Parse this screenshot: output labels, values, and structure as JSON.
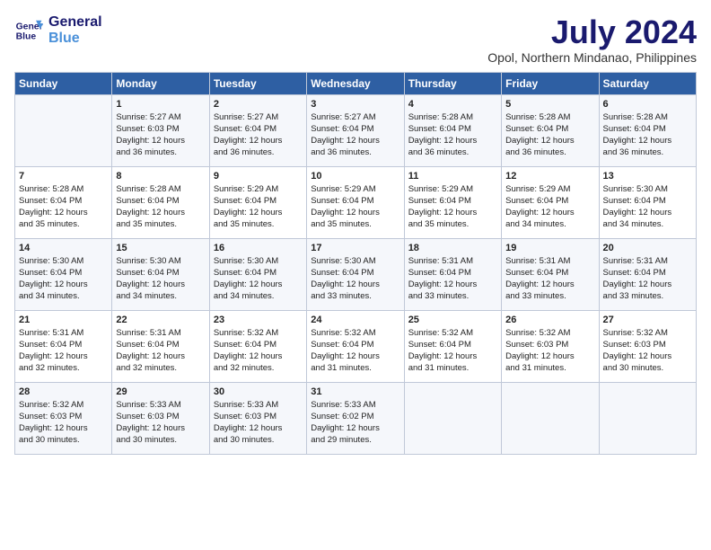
{
  "header": {
    "logo_line1": "General",
    "logo_line2": "Blue",
    "month": "July 2024",
    "location": "Opol, Northern Mindanao, Philippines"
  },
  "days_of_week": [
    "Sunday",
    "Monday",
    "Tuesday",
    "Wednesday",
    "Thursday",
    "Friday",
    "Saturday"
  ],
  "weeks": [
    [
      {
        "day": "",
        "info": ""
      },
      {
        "day": "1",
        "info": "Sunrise: 5:27 AM\nSunset: 6:03 PM\nDaylight: 12 hours\nand 36 minutes."
      },
      {
        "day": "2",
        "info": "Sunrise: 5:27 AM\nSunset: 6:04 PM\nDaylight: 12 hours\nand 36 minutes."
      },
      {
        "day": "3",
        "info": "Sunrise: 5:27 AM\nSunset: 6:04 PM\nDaylight: 12 hours\nand 36 minutes."
      },
      {
        "day": "4",
        "info": "Sunrise: 5:28 AM\nSunset: 6:04 PM\nDaylight: 12 hours\nand 36 minutes."
      },
      {
        "day": "5",
        "info": "Sunrise: 5:28 AM\nSunset: 6:04 PM\nDaylight: 12 hours\nand 36 minutes."
      },
      {
        "day": "6",
        "info": "Sunrise: 5:28 AM\nSunset: 6:04 PM\nDaylight: 12 hours\nand 36 minutes."
      }
    ],
    [
      {
        "day": "7",
        "info": "Sunrise: 5:28 AM\nSunset: 6:04 PM\nDaylight: 12 hours\nand 35 minutes."
      },
      {
        "day": "8",
        "info": "Sunrise: 5:28 AM\nSunset: 6:04 PM\nDaylight: 12 hours\nand 35 minutes."
      },
      {
        "day": "9",
        "info": "Sunrise: 5:29 AM\nSunset: 6:04 PM\nDaylight: 12 hours\nand 35 minutes."
      },
      {
        "day": "10",
        "info": "Sunrise: 5:29 AM\nSunset: 6:04 PM\nDaylight: 12 hours\nand 35 minutes."
      },
      {
        "day": "11",
        "info": "Sunrise: 5:29 AM\nSunset: 6:04 PM\nDaylight: 12 hours\nand 35 minutes."
      },
      {
        "day": "12",
        "info": "Sunrise: 5:29 AM\nSunset: 6:04 PM\nDaylight: 12 hours\nand 34 minutes."
      },
      {
        "day": "13",
        "info": "Sunrise: 5:30 AM\nSunset: 6:04 PM\nDaylight: 12 hours\nand 34 minutes."
      }
    ],
    [
      {
        "day": "14",
        "info": "Sunrise: 5:30 AM\nSunset: 6:04 PM\nDaylight: 12 hours\nand 34 minutes."
      },
      {
        "day": "15",
        "info": "Sunrise: 5:30 AM\nSunset: 6:04 PM\nDaylight: 12 hours\nand 34 minutes."
      },
      {
        "day": "16",
        "info": "Sunrise: 5:30 AM\nSunset: 6:04 PM\nDaylight: 12 hours\nand 34 minutes."
      },
      {
        "day": "17",
        "info": "Sunrise: 5:30 AM\nSunset: 6:04 PM\nDaylight: 12 hours\nand 33 minutes."
      },
      {
        "day": "18",
        "info": "Sunrise: 5:31 AM\nSunset: 6:04 PM\nDaylight: 12 hours\nand 33 minutes."
      },
      {
        "day": "19",
        "info": "Sunrise: 5:31 AM\nSunset: 6:04 PM\nDaylight: 12 hours\nand 33 minutes."
      },
      {
        "day": "20",
        "info": "Sunrise: 5:31 AM\nSunset: 6:04 PM\nDaylight: 12 hours\nand 33 minutes."
      }
    ],
    [
      {
        "day": "21",
        "info": "Sunrise: 5:31 AM\nSunset: 6:04 PM\nDaylight: 12 hours\nand 32 minutes."
      },
      {
        "day": "22",
        "info": "Sunrise: 5:31 AM\nSunset: 6:04 PM\nDaylight: 12 hours\nand 32 minutes."
      },
      {
        "day": "23",
        "info": "Sunrise: 5:32 AM\nSunset: 6:04 PM\nDaylight: 12 hours\nand 32 minutes."
      },
      {
        "day": "24",
        "info": "Sunrise: 5:32 AM\nSunset: 6:04 PM\nDaylight: 12 hours\nand 31 minutes."
      },
      {
        "day": "25",
        "info": "Sunrise: 5:32 AM\nSunset: 6:04 PM\nDaylight: 12 hours\nand 31 minutes."
      },
      {
        "day": "26",
        "info": "Sunrise: 5:32 AM\nSunset: 6:03 PM\nDaylight: 12 hours\nand 31 minutes."
      },
      {
        "day": "27",
        "info": "Sunrise: 5:32 AM\nSunset: 6:03 PM\nDaylight: 12 hours\nand 30 minutes."
      }
    ],
    [
      {
        "day": "28",
        "info": "Sunrise: 5:32 AM\nSunset: 6:03 PM\nDaylight: 12 hours\nand 30 minutes."
      },
      {
        "day": "29",
        "info": "Sunrise: 5:33 AM\nSunset: 6:03 PM\nDaylight: 12 hours\nand 30 minutes."
      },
      {
        "day": "30",
        "info": "Sunrise: 5:33 AM\nSunset: 6:03 PM\nDaylight: 12 hours\nand 30 minutes."
      },
      {
        "day": "31",
        "info": "Sunrise: 5:33 AM\nSunset: 6:02 PM\nDaylight: 12 hours\nand 29 minutes."
      },
      {
        "day": "",
        "info": ""
      },
      {
        "day": "",
        "info": ""
      },
      {
        "day": "",
        "info": ""
      }
    ]
  ]
}
